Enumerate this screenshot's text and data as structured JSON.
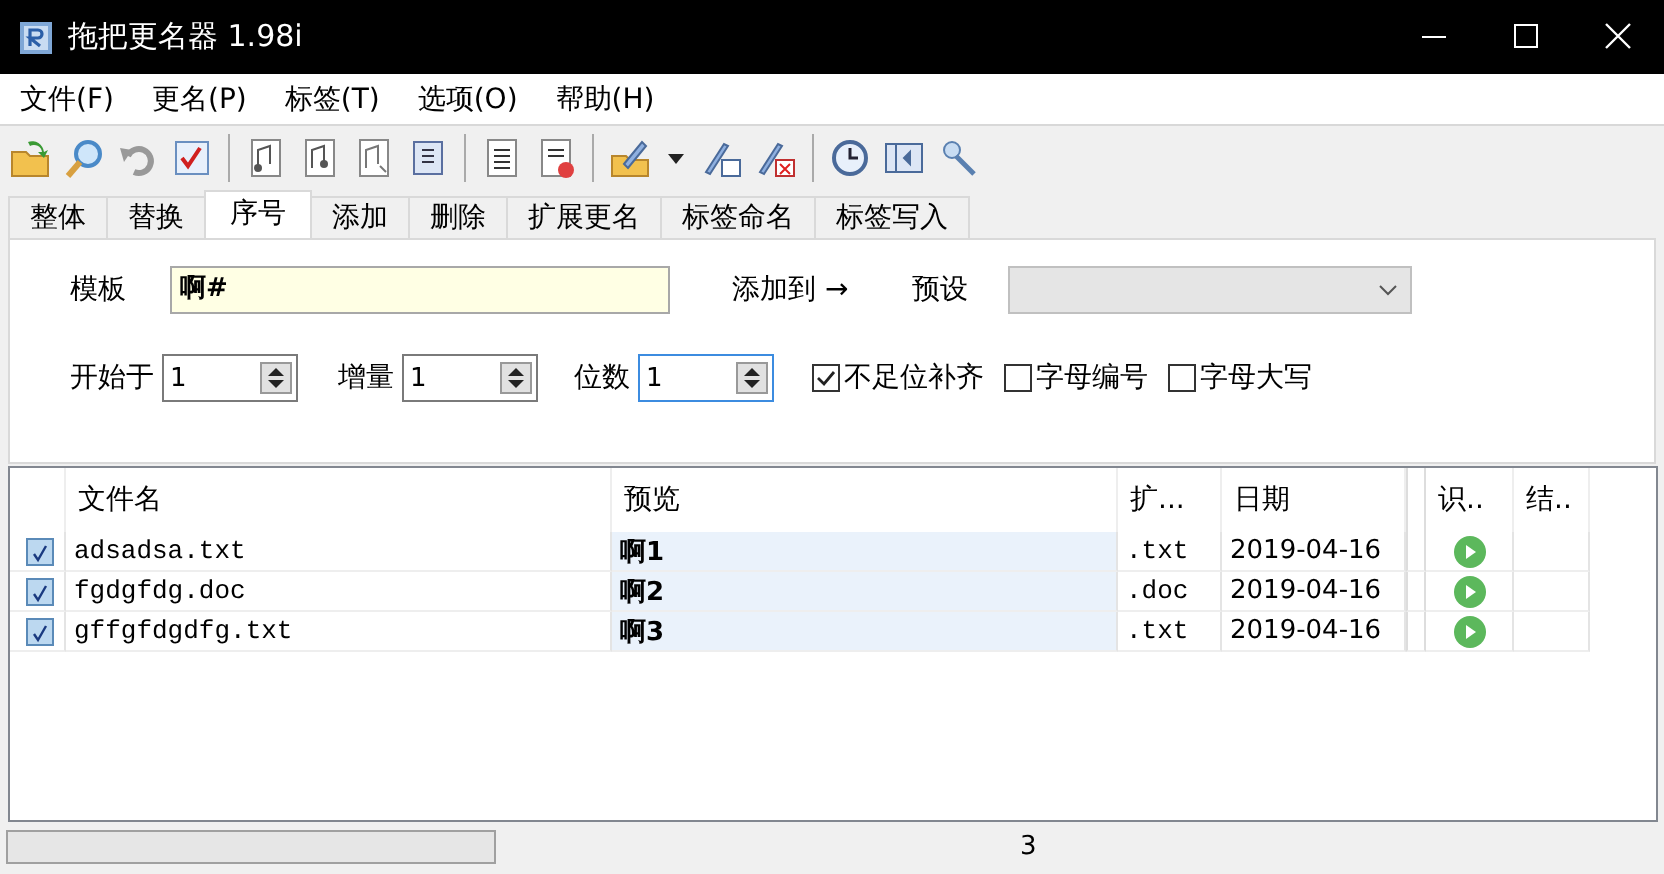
{
  "window": {
    "title": "拖把更名器 1.98i"
  },
  "menu": [
    {
      "label": "文件(F)"
    },
    {
      "label": "更名(P)"
    },
    {
      "label": "标签(T)"
    },
    {
      "label": "选项(O)"
    },
    {
      "label": "帮助(H)"
    }
  ],
  "tabs": [
    {
      "label": "整体",
      "selected": false
    },
    {
      "label": "替换",
      "selected": false
    },
    {
      "label": "序号",
      "selected": true
    },
    {
      "label": "添加",
      "selected": false
    },
    {
      "label": "删除",
      "selected": false
    },
    {
      "label": "扩展更名",
      "selected": false
    },
    {
      "label": "标签命名",
      "selected": false
    },
    {
      "label": "标签写入",
      "selected": false
    }
  ],
  "panel": {
    "template": {
      "label": "模板",
      "value": "啊#"
    },
    "add_to": {
      "label": "添加到 →"
    },
    "preset": {
      "label": "预设"
    },
    "spinners": [
      {
        "label": "开始于",
        "value": "1",
        "focused": false
      },
      {
        "label": "增量",
        "value": "1",
        "focused": false
      },
      {
        "label": "位数",
        "value": "1",
        "focused": true
      }
    ],
    "checkboxes": [
      {
        "label": "不足位补齐",
        "checked": true
      },
      {
        "label": "字母编号",
        "checked": false
      },
      {
        "label": "字母大写",
        "checked": false
      }
    ]
  },
  "table": {
    "columns": [
      "文件名",
      "预览",
      "扩...",
      "日期",
      "识..",
      "结.."
    ],
    "rows": [
      {
        "checked": true,
        "name": "adsadsa.txt",
        "preview": "啊1",
        "ext": ".txt",
        "date": "2019-04-16"
      },
      {
        "checked": true,
        "name": "fgdgfdg.doc",
        "preview": "啊2",
        "ext": ".doc",
        "date": "2019-04-16"
      },
      {
        "checked": true,
        "name": "gffgfdgdfg.txt",
        "preview": "啊3",
        "ext": ".txt",
        "date": "2019-04-16"
      }
    ]
  },
  "status_bar": {
    "count": "3"
  }
}
